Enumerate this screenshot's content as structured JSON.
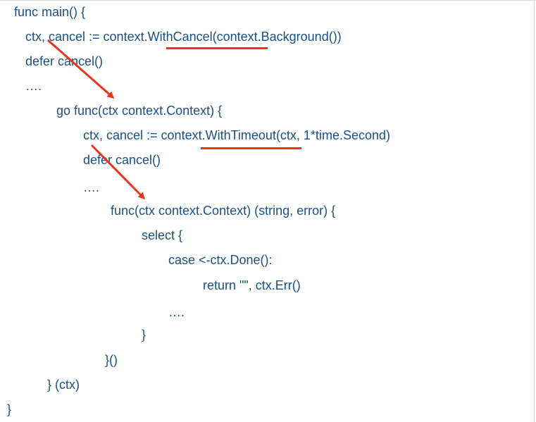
{
  "code_lines": [
    "func main() {",
    "ctx, cancel := context.WithCancel(context.Background())",
    "defer cancel()",
    "….",
    "go func(ctx context.Context) {",
    "ctx, cancel := context.WithTimeout(ctx, 1*time.Second)",
    "defer cancel()",
    "….",
    "func(ctx context.Context) (string, error) {",
    "select {",
    "case <-ctx.Done():",
    "return \"\", ctx.Err()",
    "….",
    "}",
    "}()",
    "} (ctx)",
    "}"
  ],
  "colors": {
    "code_text": "#1a4f86",
    "annotation": "#e8341c",
    "frame": "#d9d9d9",
    "background": "#ffffff"
  },
  "annotations": {
    "underlines": [
      "WithCancel(context",
      "WithTimeout(ctx"
    ],
    "arrows": [
      "ctx from WithCancel passed into go func",
      "ctx from WithTimeout passed into inner func"
    ]
  }
}
